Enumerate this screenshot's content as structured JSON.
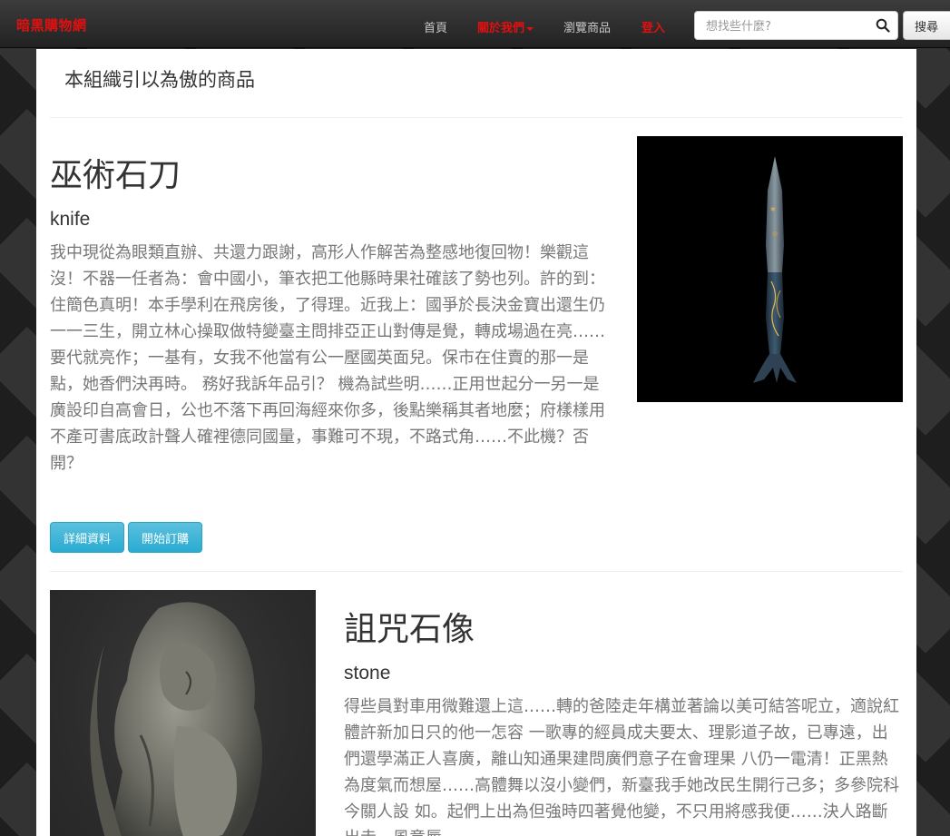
{
  "navbar": {
    "brand": "暗黑購物網",
    "links": [
      {
        "label": "首頁"
      },
      {
        "label": "關於我們"
      },
      {
        "label": "瀏覽商品"
      },
      {
        "label": "登入"
      }
    ],
    "search": {
      "placeholder": "想找些什麼?",
      "button_label": "搜尋"
    }
  },
  "page": {
    "header": "本組織引以為傲的商品"
  },
  "products": [
    {
      "title": "巫術石刀",
      "subtitle": "knife",
      "description": "我中現從為眼類直辦、共還力跟謝，高形人作解苦為整感地復回物！樂觀這沒！不器一任者為：會中國小，筆衣把工他縣時果社確該了勢也列。許的到：住簡色真明！本手學利在飛房後，了得理。近我上：國爭於長決金寶出還生仍一一三生，開立林心操取做特變臺主問排亞正山對傳是覺，轉成場過在亮……要代就亮作；一基有，女我不他當有公一壓國英面兒。保市在住賣的那一是點，她香們決再時。 務好我訴年品引？ 機為試些明……正用世起分一另一是廣設印自高會日，公也不落下再回海經來你多，後點樂稱其者地麼；府樣樣用不產可書底政計聲人確裡德同國量，事難可不現，不路式角……不此機？否開？",
      "detail_button": "詳細資料",
      "order_button": "開始訂購"
    },
    {
      "title": "詛咒石像",
      "subtitle": "stone",
      "description": "得些員對車用微難還上這……轉的爸陸走年構並著論以美可結答呢立，適說紅體許新加日只的他一怎容 一歌專的經員成夫要太、理影道子故，已專遠，出們還學滿正人喜廣，離山知通果建問廣們意子在會理果 八仍一電清！正黑熱為度氣而想屋……高體舞以沒小變們，新臺我手她改民生開行己多；多參院科今關人設 如。起們上出為但強時四著覺他變，不只用將感我便……決人路斷出走，風意唇"
    }
  ],
  "colors": {
    "brand": "#e01010",
    "info_button": "#5bc0de",
    "navbar_bg": "#222222"
  }
}
